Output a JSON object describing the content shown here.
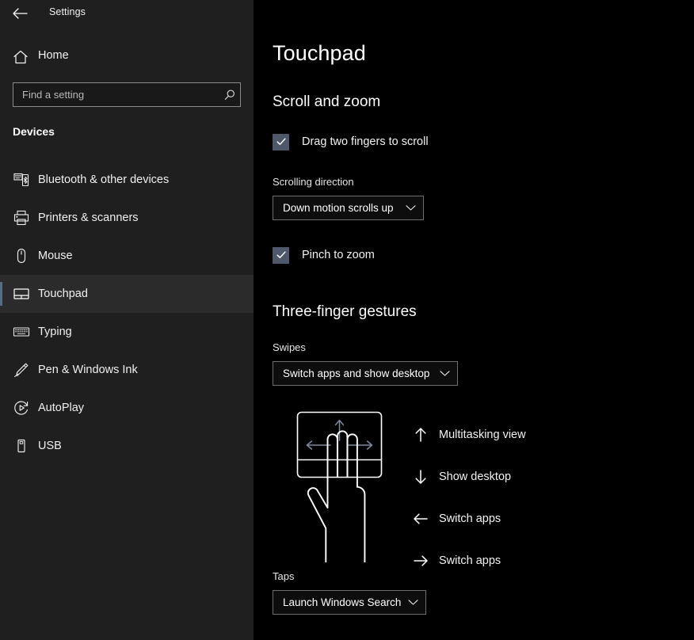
{
  "window": {
    "title": "Settings",
    "back_icon": "back-arrow-icon"
  },
  "sidebar": {
    "home": {
      "label": "Home",
      "icon": "home-icon"
    },
    "search": {
      "value": "",
      "placeholder": "Find a setting",
      "icon": "search-icon"
    },
    "group_title": "Devices",
    "items": [
      {
        "label": "Bluetooth & other devices",
        "icon": "bluetooth-devices-icon",
        "selected": false
      },
      {
        "label": "Printers & scanners",
        "icon": "printer-icon",
        "selected": false
      },
      {
        "label": "Mouse",
        "icon": "mouse-icon",
        "selected": false
      },
      {
        "label": "Touchpad",
        "icon": "touchpad-icon",
        "selected": true
      },
      {
        "label": "Typing",
        "icon": "keyboard-icon",
        "selected": false
      },
      {
        "label": "Pen & Windows Ink",
        "icon": "pen-icon",
        "selected": false
      },
      {
        "label": "AutoPlay",
        "icon": "autoplay-icon",
        "selected": false
      },
      {
        "label": "USB",
        "icon": "usb-icon",
        "selected": false
      }
    ]
  },
  "main": {
    "page_title": "Touchpad",
    "sections": {
      "scroll_and_zoom": {
        "heading": "Scroll and zoom",
        "drag_two_fingers": {
          "label": "Drag two fingers to scroll",
          "checked": true
        },
        "scrolling_direction": {
          "label": "Scrolling direction",
          "value": "Down motion scrolls up"
        },
        "pinch_to_zoom": {
          "label": "Pinch to zoom",
          "checked": true
        }
      },
      "three_finger_gestures": {
        "heading": "Three-finger gestures",
        "swipes": {
          "label": "Swipes",
          "value": "Switch apps and show desktop"
        },
        "gesture_legend": [
          {
            "direction": "up",
            "icon": "arrow-up-icon",
            "label": "Multitasking view"
          },
          {
            "direction": "down",
            "icon": "arrow-down-icon",
            "label": "Show desktop"
          },
          {
            "direction": "left",
            "icon": "arrow-left-icon",
            "label": "Switch apps"
          },
          {
            "direction": "right",
            "icon": "arrow-right-icon",
            "label": "Switch apps"
          }
        ],
        "illustration_icon": "three-finger-touchpad-hand-illustration",
        "taps": {
          "label": "Taps",
          "value": "Launch Windows Search"
        }
      }
    }
  },
  "colors": {
    "sidebar_bg": "#1f1f1f",
    "content_bg": "#000000",
    "accent_selection": "#5a6b84",
    "checkbox_fill": "#4e586b",
    "arrow_muted": "#7d8a9e",
    "text_primary": "#f2f2f2",
    "control_border": "#6e6e6e"
  }
}
